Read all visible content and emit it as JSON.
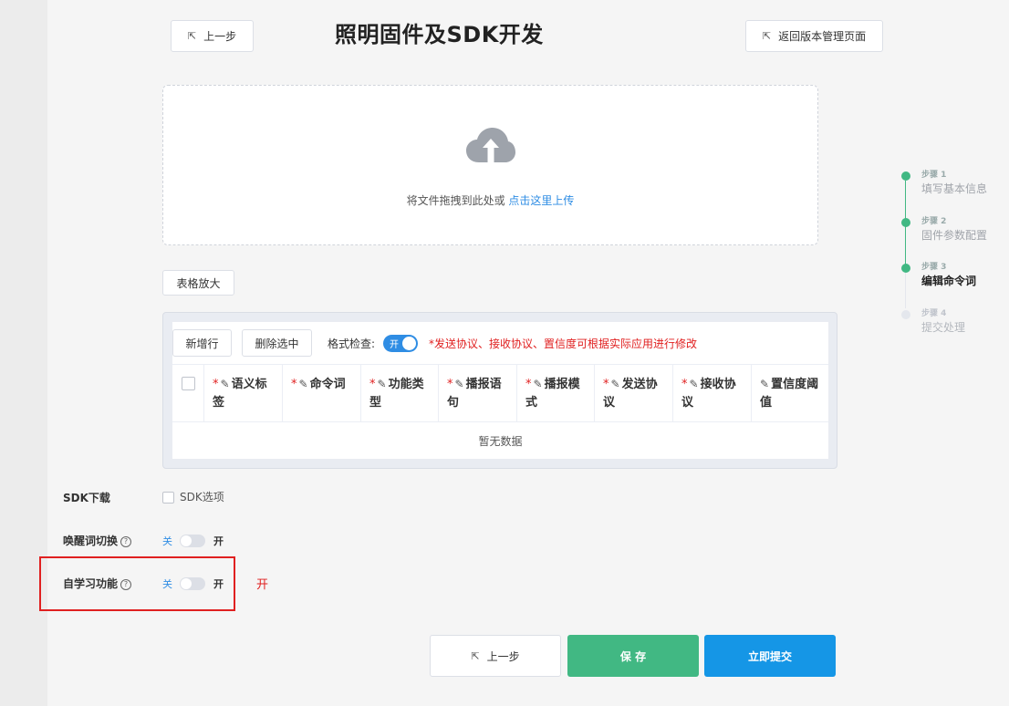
{
  "header": {
    "prev_label": "上一步",
    "title": "照明固件及SDK开发",
    "back_label": "返回版本管理页面"
  },
  "upload": {
    "text": "将文件拖拽到此处或 ",
    "link": "点击这里上传"
  },
  "steps": [
    {
      "num": "步骤 1",
      "label": "填写基本信息",
      "state": "done"
    },
    {
      "num": "步骤 2",
      "label": "固件参数配置",
      "state": "done"
    },
    {
      "num": "步骤 3",
      "label": "编辑命令词",
      "state": "active"
    },
    {
      "num": "步骤 4",
      "label": "提交处理",
      "state": "pending"
    }
  ],
  "table": {
    "enlarge_label": "表格放大",
    "add_row_label": "新增行",
    "delete_selected_label": "删除选中",
    "format_check_label": "格式检查:",
    "format_switch_text": "开",
    "hint": "*发送协议、接收协议、置信度可根据实际应用进行修改",
    "columns": [
      {
        "line1": "语义标",
        "line2": "签"
      },
      {
        "line1": "命令词",
        "line2": ""
      },
      {
        "line1": "功能类",
        "line2": "型"
      },
      {
        "line1": "播报语",
        "line2": "句"
      },
      {
        "line1": "播报模",
        "line2": "式"
      },
      {
        "line1": "发送协",
        "line2": "议"
      },
      {
        "line1": "接收协",
        "line2": "议"
      },
      {
        "line1": "置信度阈",
        "line2": "值"
      }
    ],
    "empty_text": "暂无数据"
  },
  "form": {
    "sdk_label": "SDK下载",
    "sdk_option": "SDK选项",
    "wake_label": "唤醒词切换",
    "self_learn_label": "自学习功能",
    "off_text": "关",
    "on_text": "开",
    "annotation": "开"
  },
  "footer": {
    "prev_label": "上一步",
    "save_label": "保 存",
    "submit_label": "立即提交"
  },
  "colors": {
    "accent": "#2f8de4",
    "success": "#41b883",
    "submit": "#1596e6",
    "warning": "#e02020"
  }
}
